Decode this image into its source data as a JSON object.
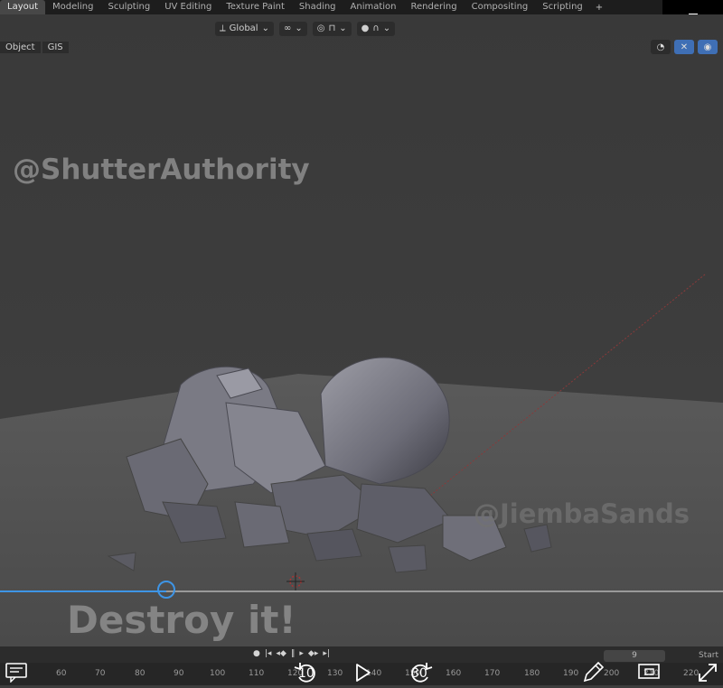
{
  "workspace_tabs": [
    "Layout",
    "Modeling",
    "Sculpting",
    "UV Editing",
    "Texture Paint",
    "Shading",
    "Animation",
    "Rendering",
    "Compositing",
    "Scripting"
  ],
  "active_tab": "Layout",
  "add_tab_label": "+",
  "viewport_menu": [
    "Object",
    "GIS"
  ],
  "transform_orientation": "Global",
  "watermarks": {
    "top": "@ShutterAuthority",
    "bottom": "@JiembaSands"
  },
  "caption": "Destroy it!",
  "timeline": {
    "frame_numbers": [
      "60",
      "70",
      "80",
      "90",
      "100",
      "110",
      "120",
      "130",
      "140",
      "150",
      "160",
      "170",
      "180",
      "190",
      "200",
      "210",
      "220"
    ],
    "current_frame": "9",
    "start_label": "Start"
  },
  "player": {
    "skip_back_label": "10",
    "skip_forward_label": "30",
    "progress_fraction": 0.23
  },
  "colors": {
    "accent": "#3e95e6",
    "background": "#3d3d3d"
  }
}
